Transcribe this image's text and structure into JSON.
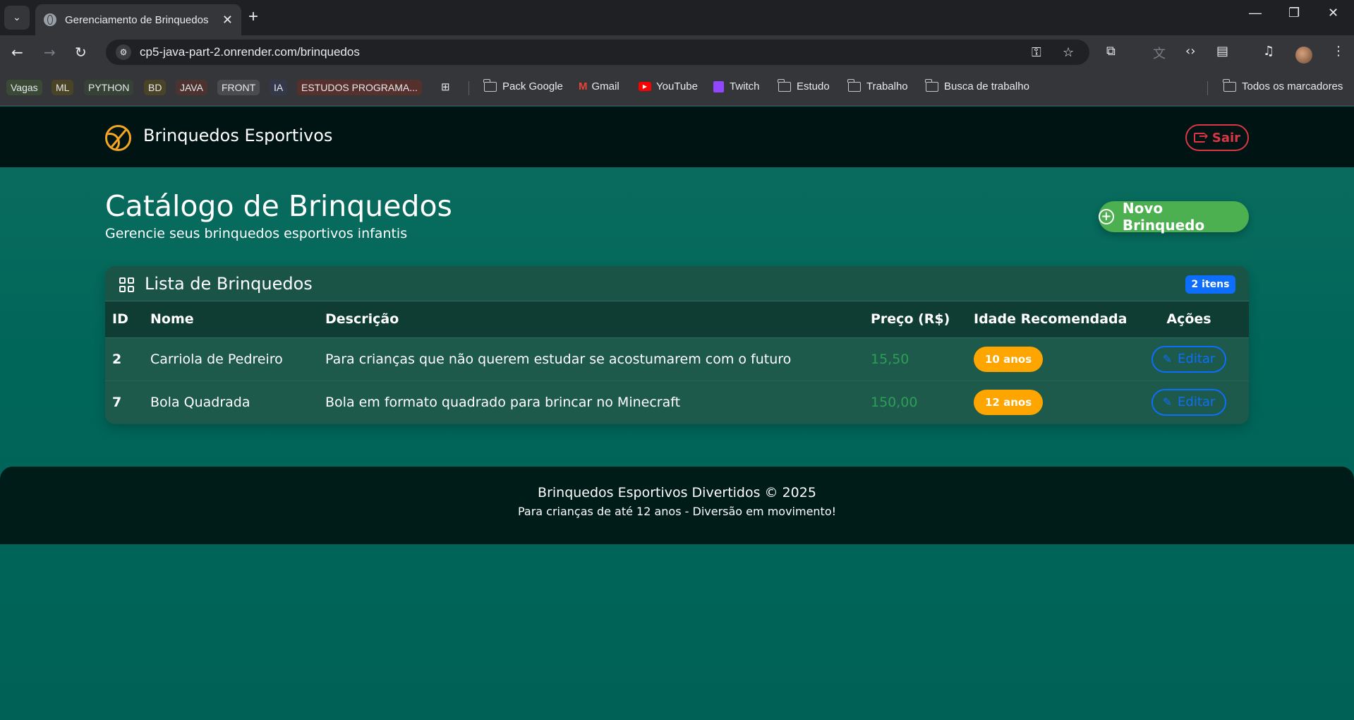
{
  "browser": {
    "tab_title": "Gerenciamento de Brinquedos",
    "tab_close": "✕",
    "new_tab": "+",
    "url": "cp5-java-part-2.onrender.com/brinquedos",
    "bookmarks": {
      "chips": [
        {
          "label": "Vagas",
          "bg": "#3b4a37",
          "color": "#e8eaed"
        },
        {
          "label": "ML",
          "bg": "#4a4326",
          "color": "#e8eaed"
        },
        {
          "label": "PYTHON",
          "bg": "#374237",
          "color": "#e8eaed"
        },
        {
          "label": "BD",
          "bg": "#4a4326",
          "color": "#e8eaed"
        },
        {
          "label": "JAVA",
          "bg": "#4d3330",
          "color": "#e8eaed"
        },
        {
          "label": "FRONT",
          "bg": "#4a4b4f",
          "color": "#e8eaed"
        },
        {
          "label": "IA",
          "bg": "#33394a",
          "color": "#e8eaed"
        },
        {
          "label": "ESTUDOS PROGRAMA...",
          "bg": "#55302d",
          "color": "#e8eaed"
        }
      ],
      "items": [
        "Pack Google",
        "Gmail",
        "YouTube",
        "Twitch",
        "Estudo",
        "Trabalho",
        "Busca de trabalho"
      ],
      "all_bookmarks": "Todos os marcadores"
    }
  },
  "app": {
    "brand": "Brinquedos Esportivos",
    "logout_label": "Sair",
    "title": "Catálogo de Brinquedos",
    "subtitle": "Gerencie seus brinquedos esportivos infantis",
    "new_button_label": "Novo Brinquedo",
    "list_title": "Lista de Brinquedos",
    "count_badge": "2 itens",
    "columns": {
      "id": "ID",
      "name": "Nome",
      "description": "Descrição",
      "price": "Preço (R$)",
      "age": "Idade Recomendada",
      "actions": "Ações"
    },
    "rows": [
      {
        "id": "2",
        "name": "Carriola de Pedreiro",
        "description": "Para crianças que não querem estudar se acostumarem com o futuro",
        "price": "15,50",
        "age": "10 anos",
        "action": "Editar"
      },
      {
        "id": "7",
        "name": "Bola Quadrada",
        "description": "Bola em formato quadrado para brincar no Minecraft",
        "price": "150,00",
        "age": "12 anos",
        "action": "Editar"
      }
    ],
    "footer": {
      "line1": "Brinquedos Esportivos Divertidos © 2025",
      "line2": "Para crianças de até 12 anos - Diversão em movimento!"
    }
  },
  "colors": {
    "page_bg": "#01665a",
    "navbar_bg": "#001513",
    "accent_orange": "#f5a623",
    "danger": "#dc3545",
    "success": "#4caf50",
    "primary": "#0d6efd",
    "price_green": "#2e9e57"
  }
}
